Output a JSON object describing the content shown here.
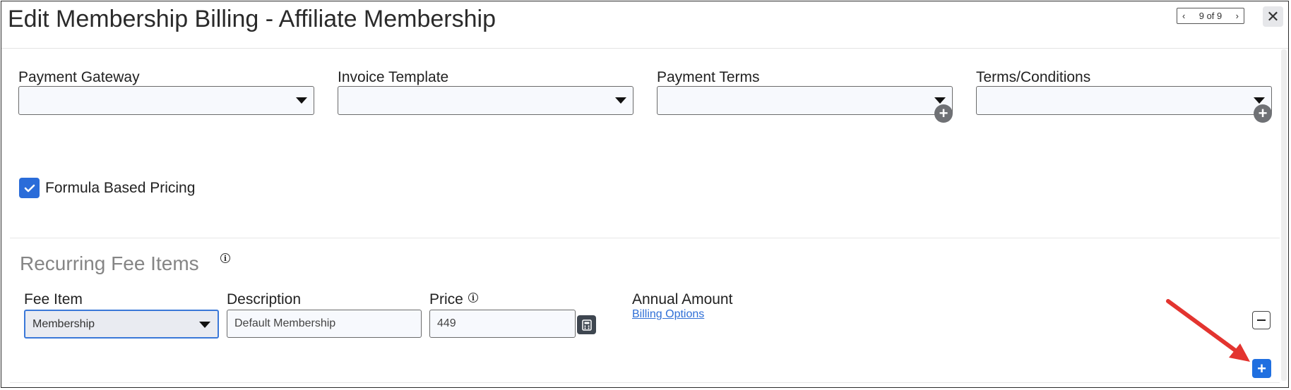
{
  "header": {
    "title": "Edit Membership Billing - Affiliate Membership",
    "pager": {
      "text": "9 of 9"
    }
  },
  "fields": [
    {
      "label": "Payment Gateway",
      "value": ""
    },
    {
      "label": "Invoice Template",
      "value": ""
    },
    {
      "label": "Payment Terms",
      "value": ""
    },
    {
      "label": "Terms/Conditions",
      "value": ""
    }
  ],
  "formula_pricing": {
    "label": "Formula Based Pricing",
    "checked": true
  },
  "recurring": {
    "title": "Recurring Fee Items",
    "columns": {
      "fee_item": "Fee Item",
      "description": "Description",
      "price": "Price",
      "annual_amount": "Annual Amount"
    },
    "row": {
      "fee_item": "Membership",
      "description": "Default Membership",
      "price": "449",
      "billing_options": "Billing Options"
    }
  },
  "colors": {
    "accent": "#2a6cd9",
    "link": "#2f6fd6",
    "annotation_arrow": "#e3342f"
  },
  "icons": [
    "chevron-left-icon",
    "chevron-right-icon",
    "close-icon",
    "chevron-down-icon",
    "plus-circle-icon",
    "check-icon",
    "info-icon",
    "calculator-icon",
    "minus-icon",
    "plus-icon",
    "annotation-arrow"
  ]
}
